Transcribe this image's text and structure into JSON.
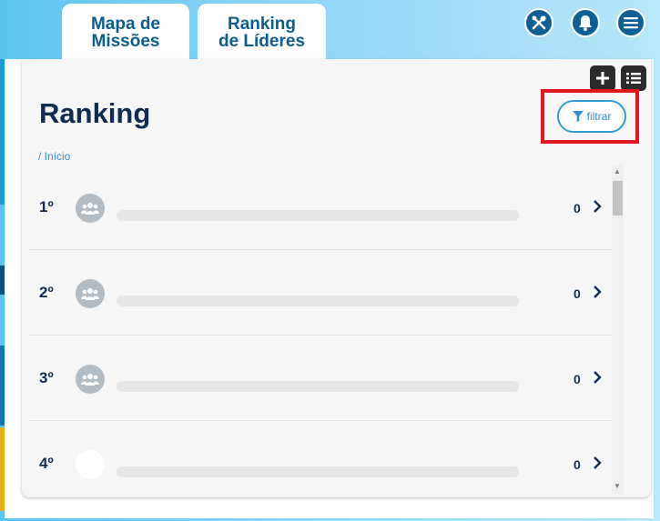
{
  "tabs": [
    {
      "label": "Mapa de\nMissões"
    },
    {
      "label": "Ranking\nde Líderes"
    }
  ],
  "header_icons": [
    "tools-icon",
    "bell-icon",
    "menu-icon"
  ],
  "toolbar_icons": [
    "plus-icon",
    "list-icon"
  ],
  "page": {
    "title": "Ranking",
    "breadcrumb": "/ Início",
    "filter_label": "filtrar"
  },
  "ranking": [
    {
      "position": "1º",
      "score": "0",
      "avatar": "group-icon"
    },
    {
      "position": "2º",
      "score": "0",
      "avatar": "group-icon"
    },
    {
      "position": "3º",
      "score": "0",
      "avatar": "group-icon"
    },
    {
      "position": "4º",
      "score": "0",
      "avatar": "blank"
    }
  ],
  "colors": {
    "brand_dark": "#0d5f95",
    "title": "#0f2d52",
    "accent": "#2f9bd9",
    "highlight": "#e1161f"
  }
}
